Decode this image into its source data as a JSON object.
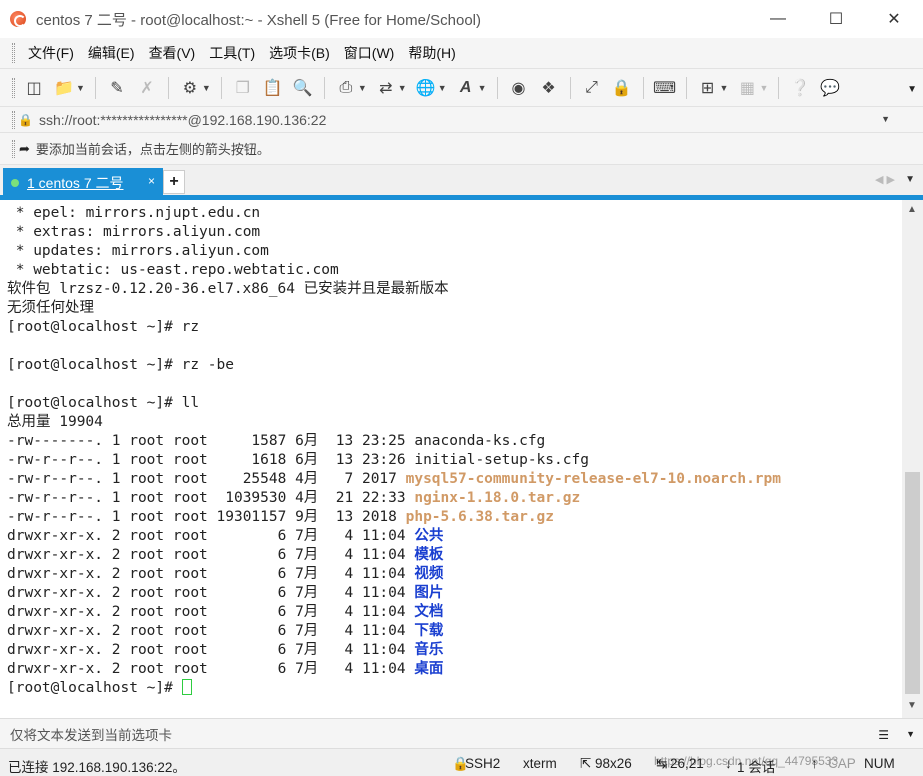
{
  "window": {
    "title": "centos 7 二号 - root@localhost:~ - Xshell 5 (Free for Home/School)",
    "minimize": "—",
    "maximize": "☐",
    "close": "✕"
  },
  "menu": [
    "文件(F)",
    "编辑(E)",
    "查看(V)",
    "工具(T)",
    "选项卡(B)",
    "窗口(W)",
    "帮助(H)"
  ],
  "toolbar_icons": [
    "new-session-icon",
    "open-folder-icon",
    "disconnect-icon",
    "reconnect-icon",
    "properties-icon",
    "copy-icon",
    "paste-icon",
    "find-icon",
    "print-icon",
    "transfer-icon",
    "globe-icon",
    "font-icon",
    "xftp-icon",
    "xmanager-icon",
    "fullscreen-icon",
    "lock-icon",
    "keyboard-icon",
    "add-tab-icon",
    "layout-icon",
    "help-icon",
    "chat-icon"
  ],
  "address": {
    "value": "ssh://root:****************@192.168.190.136:22"
  },
  "hint": {
    "text": "要添加当前会话，点击左侧的箭头按钮。"
  },
  "tabs": [
    {
      "label": "1 centos 7 二号",
      "close": "×",
      "active": true
    }
  ],
  "tab_add": "+",
  "terminal": {
    "lines": [
      {
        "parts": [
          {
            "t": " * epel: mirrors.njupt.edu.cn",
            "c": ""
          }
        ]
      },
      {
        "parts": [
          {
            "t": " * extras: mirrors.aliyun.com",
            "c": ""
          }
        ]
      },
      {
        "parts": [
          {
            "t": " * updates: mirrors.aliyun.com",
            "c": ""
          }
        ]
      },
      {
        "parts": [
          {
            "t": " * webtatic: us-east.repo.webtatic.com",
            "c": ""
          }
        ]
      },
      {
        "parts": [
          {
            "t": "软件包 lrzsz-0.12.20-36.el7.x86_64 已安装并且是最新版本",
            "c": ""
          }
        ]
      },
      {
        "parts": [
          {
            "t": "无须任何处理",
            "c": ""
          }
        ]
      },
      {
        "parts": [
          {
            "t": "[root@localhost ~]# rz",
            "c": ""
          }
        ]
      },
      {
        "parts": [
          {
            "t": "",
            "c": ""
          }
        ]
      },
      {
        "parts": [
          {
            "t": "[root@localhost ~]# rz -be",
            "c": ""
          }
        ]
      },
      {
        "parts": [
          {
            "t": "",
            "c": ""
          }
        ]
      },
      {
        "parts": [
          {
            "t": "[root@localhost ~]# ll",
            "c": ""
          }
        ]
      },
      {
        "parts": [
          {
            "t": "总用量 19904",
            "c": ""
          }
        ]
      },
      {
        "parts": [
          {
            "t": "-rw-------. 1 root root     1587 6月  13 23:25 anaconda-ks.cfg",
            "c": ""
          }
        ]
      },
      {
        "parts": [
          {
            "t": "-rw-r--r--. 1 root root     1618 6月  13 23:26 initial-setup-ks.cfg",
            "c": ""
          }
        ]
      },
      {
        "parts": [
          {
            "t": "-rw-r--r--. 1 root root    25548 4月   7 2017 ",
            "c": ""
          },
          {
            "t": "mysql57-community-release-el7-10.noarch.rpm",
            "c": "hl-gz"
          }
        ]
      },
      {
        "parts": [
          {
            "t": "-rw-r--r--. 1 root root  1039530 4月  21 22:33 ",
            "c": ""
          },
          {
            "t": "nginx-1.18.0.tar.gz",
            "c": "hl-gz"
          }
        ]
      },
      {
        "parts": [
          {
            "t": "-rw-r--r--. 1 root root 19301157 9月  13 2018 ",
            "c": ""
          },
          {
            "t": "php-5.6.38.tar.gz",
            "c": "hl-gz"
          }
        ]
      },
      {
        "parts": [
          {
            "t": "drwxr-xr-x. 2 root root        6 7月   4 11:04 ",
            "c": ""
          },
          {
            "t": "公共",
            "c": "hl-dir"
          }
        ]
      },
      {
        "parts": [
          {
            "t": "drwxr-xr-x. 2 root root        6 7月   4 11:04 ",
            "c": ""
          },
          {
            "t": "模板",
            "c": "hl-dir"
          }
        ]
      },
      {
        "parts": [
          {
            "t": "drwxr-xr-x. 2 root root        6 7月   4 11:04 ",
            "c": ""
          },
          {
            "t": "视频",
            "c": "hl-dir"
          }
        ]
      },
      {
        "parts": [
          {
            "t": "drwxr-xr-x. 2 root root        6 7月   4 11:04 ",
            "c": ""
          },
          {
            "t": "图片",
            "c": "hl-dir"
          }
        ]
      },
      {
        "parts": [
          {
            "t": "drwxr-xr-x. 2 root root        6 7月   4 11:04 ",
            "c": ""
          },
          {
            "t": "文档",
            "c": "hl-dir"
          }
        ]
      },
      {
        "parts": [
          {
            "t": "drwxr-xr-x. 2 root root        6 7月   4 11:04 ",
            "c": ""
          },
          {
            "t": "下载",
            "c": "hl-dir"
          }
        ]
      },
      {
        "parts": [
          {
            "t": "drwxr-xr-x. 2 root root        6 7月   4 11:04 ",
            "c": ""
          },
          {
            "t": "音乐",
            "c": "hl-dir"
          }
        ]
      },
      {
        "parts": [
          {
            "t": "drwxr-xr-x. 2 root root        6 7月   4 11:04 ",
            "c": ""
          },
          {
            "t": "桌面",
            "c": "hl-dir"
          }
        ]
      }
    ],
    "prompt": "[root@localhost ~]# "
  },
  "send_bar": {
    "placeholder": "仅将文本发送到当前选项卡"
  },
  "status": {
    "connection": "已连接 192.168.190.136:22。",
    "protocol": "SSH2",
    "terminal_type": "xterm",
    "size": "98x26",
    "position": "26,21",
    "sessions": "1 会话",
    "caps": "CAP",
    "num": "NUM",
    "watermark": "https://blog.csdn.net/qq_44795533"
  },
  "colors": {
    "accent": "#1a8fd6",
    "archive": "#d19a66",
    "directory": "#1a3fd0",
    "cursor": "#2ecc40"
  }
}
